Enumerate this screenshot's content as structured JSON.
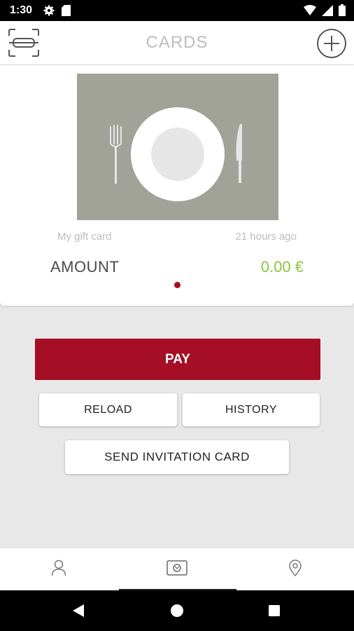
{
  "status_bar": {
    "time": "1:30"
  },
  "app_bar": {
    "title": "CARDS"
  },
  "card": {
    "name": "My gift card",
    "updated": "21 hours ago",
    "amount_label": "AMOUNT",
    "amount_value": "0.00 €"
  },
  "actions": {
    "pay": "PAY",
    "reload": "RELOAD",
    "history": "HISTORY",
    "send_invitation": "SEND INVITATION CARD"
  },
  "bottom_nav": {
    "items": [
      "profile-icon",
      "cards-icon",
      "location-pin-icon"
    ],
    "active": "cards-icon"
  },
  "colors": {
    "accent": "#a50e24",
    "amount": "#8cc63f",
    "card_bg": "#a2a398"
  }
}
